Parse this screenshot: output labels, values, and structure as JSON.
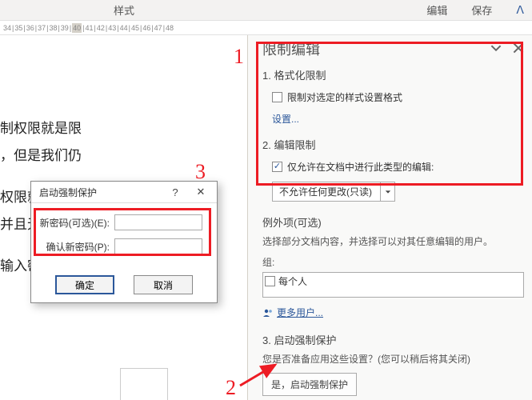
{
  "topbar": {
    "style_label": "样式",
    "edit_label": "编辑",
    "save_label": "保存",
    "chevron": "ᐱ"
  },
  "ruler": {
    "marks": [
      "34",
      "|",
      "35",
      "|",
      "36",
      "|",
      "37",
      "|",
      "38",
      "|",
      "39",
      "|",
      "40",
      "|",
      "41",
      "|",
      "42",
      "|",
      "43",
      "|",
      "44",
      "|",
      "45",
      "|",
      "46",
      "|",
      "47",
      "|",
      "48"
    ],
    "highlight_idx": 12
  },
  "doc": {
    "line1": "制权限就是限",
    "line2": "，但是我们仍",
    "line3": "权限就是禁止",
    "line4": "并且无",
    "line5": "输入密"
  },
  "panel": {
    "title": "限制编辑",
    "sec1_title": "1. 格式化限制",
    "sec1_checkbox": "限制对选定的样式设置格式",
    "sec1_settings": "设置...",
    "sec2_title": "2. 编辑限制",
    "sec2_checkbox": "仅允许在文档中进行此类型的编辑:",
    "sec2_dropdown": "不允许任何更改(只读)",
    "exceptions_title": "例外项(可选)",
    "exceptions_desc": "选择部分文档内容，并选择可以对其任意编辑的用户。",
    "group_label": "组:",
    "group_item": "每个人",
    "more_users": "更多用户...",
    "sec3_title": "3. 启动强制保护",
    "sec3_desc": "您是否准备应用这些设置？(您可以稍后将其关闭)",
    "sec3_button": "是，启动强制保护"
  },
  "dialog": {
    "title": "启动强制保护",
    "pw_label": "新密码(可选)(E):",
    "pw2_label": "确认新密码(P):",
    "ok": "确定",
    "cancel": "取消"
  },
  "annotations": {
    "n1": "1",
    "n2": "2",
    "n3": "3"
  }
}
